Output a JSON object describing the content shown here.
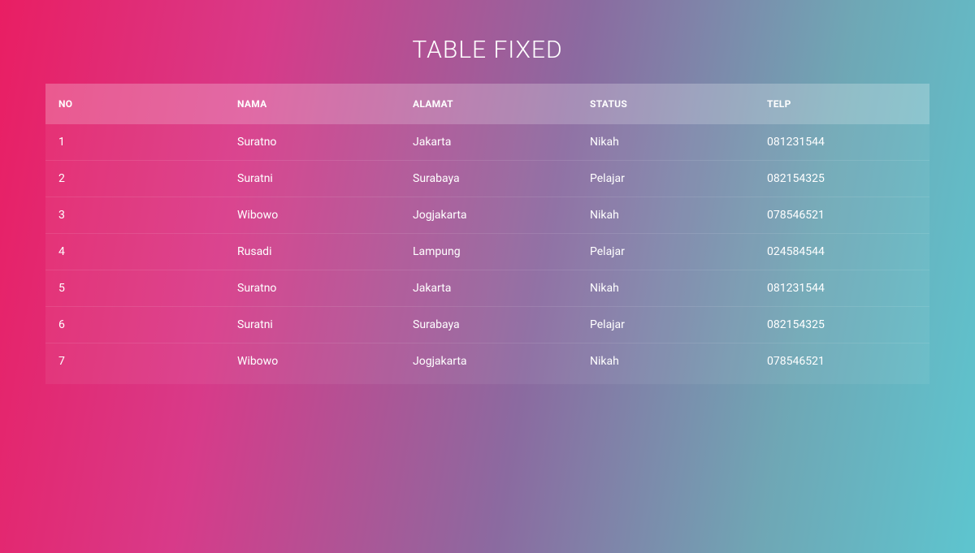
{
  "title": "TABLE FIXED",
  "columns": {
    "no": "NO",
    "nama": "NAMA",
    "alamat": "ALAMAT",
    "status": "STATUS",
    "telp": "TELP"
  },
  "rows": [
    {
      "no": "1",
      "nama": "Suratno",
      "alamat": "Jakarta",
      "status": "Nikah",
      "telp": "081231544"
    },
    {
      "no": "2",
      "nama": "Suratni",
      "alamat": "Surabaya",
      "status": "Pelajar",
      "telp": "082154325"
    },
    {
      "no": "3",
      "nama": "Wibowo",
      "alamat": "Jogjakarta",
      "status": "Nikah",
      "telp": "078546521"
    },
    {
      "no": "4",
      "nama": "Rusadi",
      "alamat": "Lampung",
      "status": "Pelajar",
      "telp": "024584544"
    },
    {
      "no": "5",
      "nama": "Suratno",
      "alamat": "Jakarta",
      "status": "Nikah",
      "telp": "081231544"
    },
    {
      "no": "6",
      "nama": "Suratni",
      "alamat": "Surabaya",
      "status": "Pelajar",
      "telp": "082154325"
    },
    {
      "no": "7",
      "nama": "Wibowo",
      "alamat": "Jogjakarta",
      "status": "Nikah",
      "telp": "078546521"
    }
  ]
}
